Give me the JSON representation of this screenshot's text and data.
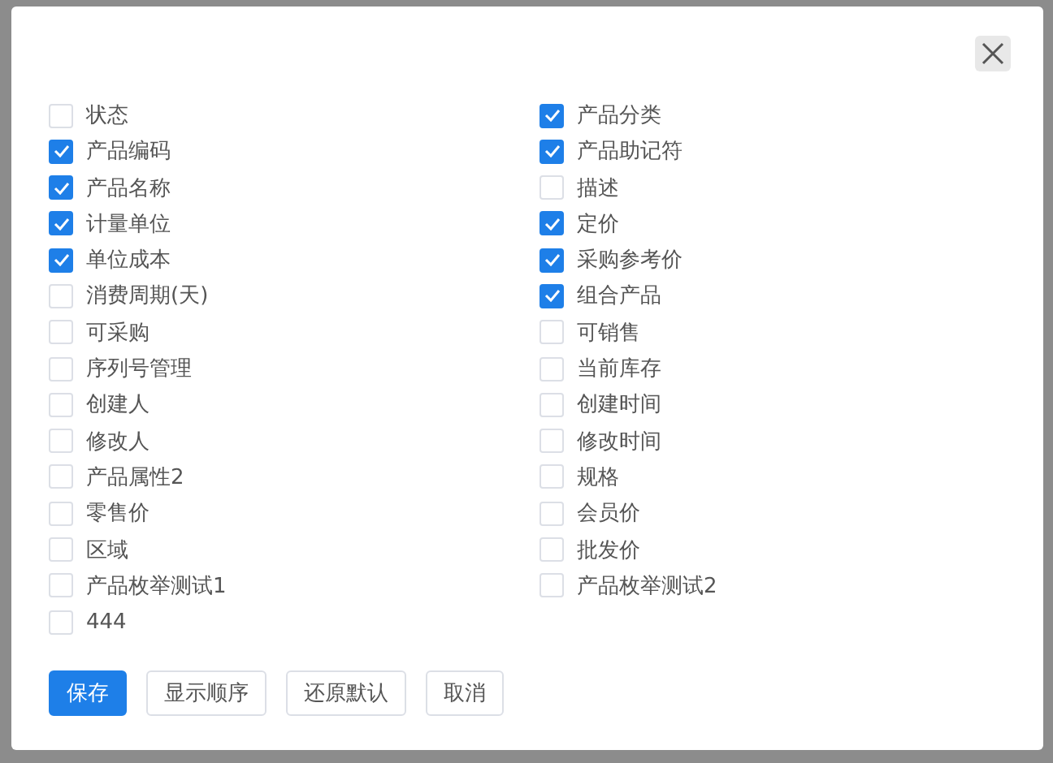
{
  "dialog": {
    "columns": [
      {
        "label": "状态",
        "checked": false
      },
      {
        "label": "产品分类",
        "checked": true
      },
      {
        "label": "产品编码",
        "checked": true
      },
      {
        "label": "产品助记符",
        "checked": true
      },
      {
        "label": "产品名称",
        "checked": true
      },
      {
        "label": "描述",
        "checked": false
      },
      {
        "label": "计量单位",
        "checked": true
      },
      {
        "label": "定价",
        "checked": true
      },
      {
        "label": "单位成本",
        "checked": true
      },
      {
        "label": "采购参考价",
        "checked": true
      },
      {
        "label": "消费周期(天)",
        "checked": false
      },
      {
        "label": "组合产品",
        "checked": true
      },
      {
        "label": "可采购",
        "checked": false
      },
      {
        "label": "可销售",
        "checked": false
      },
      {
        "label": "序列号管理",
        "checked": false
      },
      {
        "label": "当前库存",
        "checked": false
      },
      {
        "label": "创建人",
        "checked": false
      },
      {
        "label": "创建时间",
        "checked": false
      },
      {
        "label": "修改人",
        "checked": false
      },
      {
        "label": "修改时间",
        "checked": false
      },
      {
        "label": "产品属性2",
        "checked": false
      },
      {
        "label": "规格",
        "checked": false
      },
      {
        "label": "零售价",
        "checked": false
      },
      {
        "label": "会员价",
        "checked": false
      },
      {
        "label": "区域",
        "checked": false
      },
      {
        "label": "批发价",
        "checked": false
      },
      {
        "label": "产品枚举测试1",
        "checked": false
      },
      {
        "label": "产品枚举测试2",
        "checked": false
      },
      {
        "label": "444",
        "checked": false
      }
    ],
    "buttons": [
      {
        "label": "保存",
        "kind": "primary"
      },
      {
        "label": "显示顺序",
        "kind": "default"
      },
      {
        "label": "还原默认",
        "kind": "default"
      },
      {
        "label": "取消",
        "kind": "default"
      }
    ]
  }
}
